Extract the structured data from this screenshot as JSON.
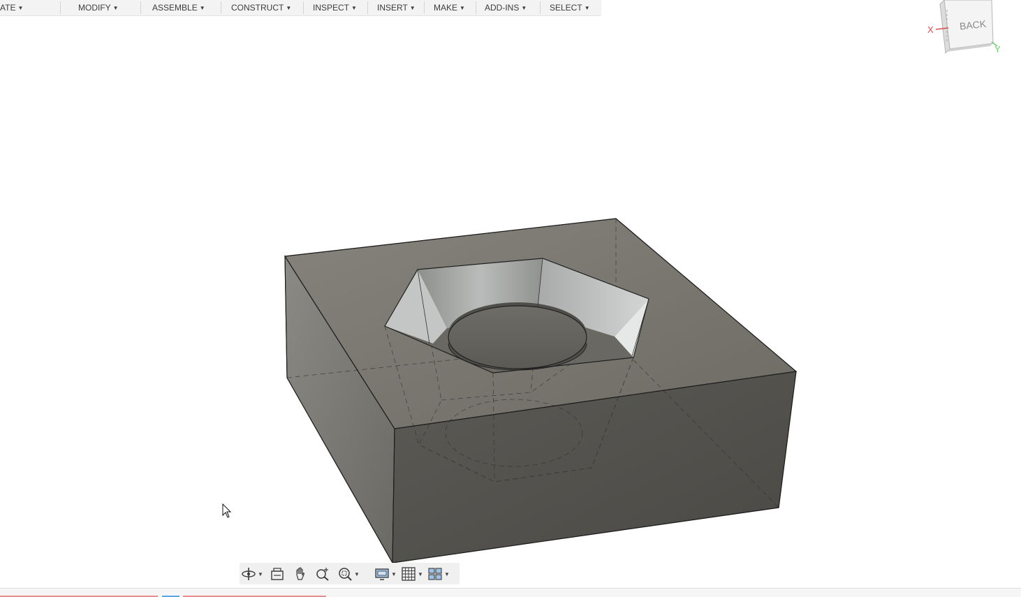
{
  "toolbar": {
    "menus": [
      {
        "label": "ATE"
      },
      {
        "label": "MODIFY"
      },
      {
        "label": "ASSEMBLE"
      },
      {
        "label": "CONSTRUCT"
      },
      {
        "label": "INSPECT"
      },
      {
        "label": "INSERT"
      },
      {
        "label": "MAKE"
      },
      {
        "label": "ADD-INS"
      },
      {
        "label": "SELECT"
      }
    ]
  },
  "viewcube": {
    "face_label": "BACK",
    "axis_x_label": "X",
    "axis_y_label": "Y",
    "axis_x_color": "#e24b4b",
    "axis_y_color": "#6bcf6b"
  },
  "navbar": {
    "tools": [
      {
        "icon": "orbit-icon",
        "has_dropdown": true
      },
      {
        "icon": "look-at-icon",
        "has_dropdown": false
      },
      {
        "icon": "pan-hand-icon",
        "has_dropdown": false
      },
      {
        "icon": "zoom-icon",
        "has_dropdown": false
      },
      {
        "icon": "fit-zoom-icon",
        "has_dropdown": true
      },
      {
        "icon": "display-settings-icon",
        "has_dropdown": true
      },
      {
        "icon": "grid-icon",
        "has_dropdown": true
      },
      {
        "icon": "viewports-icon",
        "has_dropdown": true
      }
    ]
  },
  "model": {
    "body_color": "#7a7870",
    "edge_color": "#2a2a2a"
  }
}
